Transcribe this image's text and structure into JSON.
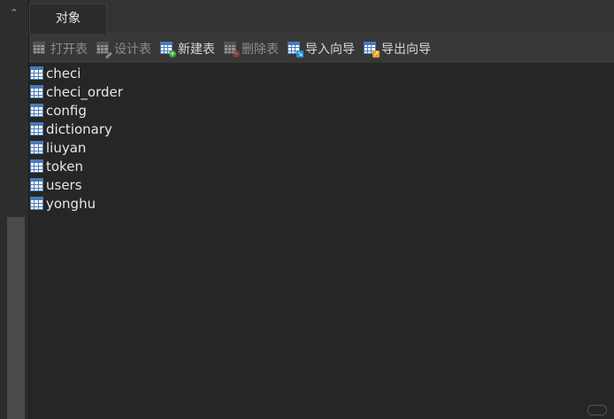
{
  "tabs": [
    {
      "label": "对象"
    }
  ],
  "toolbar": {
    "open_table": "打开表",
    "design_table": "设计表",
    "new_table": "新建表",
    "delete_table": "删除表",
    "import_wizard": "导入向导",
    "export_wizard": "导出向导"
  },
  "tables": [
    {
      "name": "checi"
    },
    {
      "name": "checi_order"
    },
    {
      "name": "config"
    },
    {
      "name": "dictionary"
    },
    {
      "name": "liuyan"
    },
    {
      "name": "token"
    },
    {
      "name": "users"
    },
    {
      "name": "yonghu"
    }
  ],
  "colors": {
    "background": "#262626",
    "toolbar": "#383838",
    "accent": "#3f8fe0",
    "table_icon": "#4a7ab8"
  }
}
